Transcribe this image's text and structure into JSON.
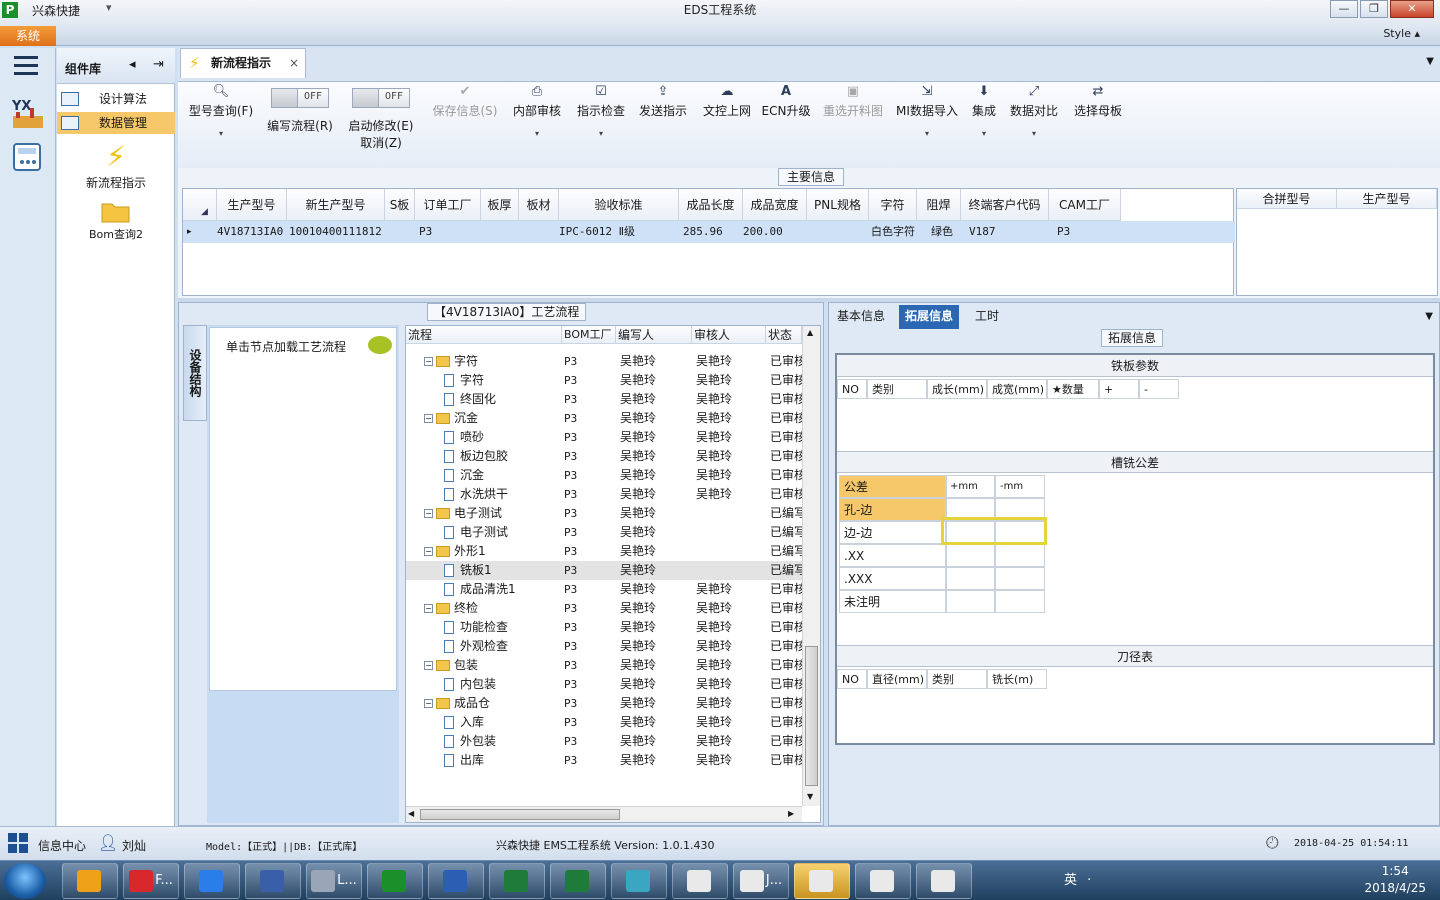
{
  "app": {
    "name": "兴森快捷",
    "title": "EDS工程系统",
    "system_tab": "系统",
    "style_label": "Style"
  },
  "window_buttons": {
    "min": "—",
    "max": "❐",
    "close": "✕"
  },
  "components": {
    "title": "组件库",
    "items": [
      {
        "label": "设计算法"
      },
      {
        "label": "数据管理"
      }
    ],
    "big_buttons": [
      {
        "label": "新流程指示"
      },
      {
        "label": "Bom查询2"
      }
    ]
  },
  "doc_tab": {
    "label": "新流程指示",
    "close": "×"
  },
  "ribbon": [
    {
      "label": "型号查询(F)",
      "icon": "magnifier-icon",
      "dd": "▾"
    },
    {
      "label": "编写流程(R)",
      "toggle": "OFF"
    },
    {
      "label": "启动修改(E)",
      "label2": "取消(Z)",
      "toggle": "OFF"
    },
    {
      "label": "保存信息(S)",
      "icon": "check-icon",
      "disabled": true
    },
    {
      "label": "内部审核",
      "icon": "print-icon",
      "dd": "▾"
    },
    {
      "label": "指示检查",
      "icon": "checkbox-icon",
      "dd": "▾"
    },
    {
      "label": "发送指示",
      "icon": "upload-icon"
    },
    {
      "label": "文控上网",
      "icon": "cloud-upload-icon"
    },
    {
      "label": "ECN升级",
      "icon": "ecn-icon"
    },
    {
      "label": "重选开料图",
      "icon": "image-icon",
      "disabled": true
    },
    {
      "label": "MI数据导入",
      "icon": "import-icon",
      "dd": "▾"
    },
    {
      "label": "集成",
      "icon": "download-icon",
      "dd": "▾"
    },
    {
      "label": "数据对比",
      "icon": "compare-icon",
      "dd": "▾"
    },
    {
      "label": "选择母板",
      "icon": "shuffle-icon"
    }
  ],
  "main_info": {
    "label": "主要信息",
    "columns": [
      "生产型号",
      "新生产型号",
      "S板",
      "订单工厂",
      "板厚",
      "板材",
      "验收标准",
      "成品长度",
      "成品宽度",
      "PNL规格",
      "字符",
      "阻焊",
      "终端客户代码",
      "CAM工厂"
    ],
    "row": [
      "4V18713IA0",
      "10010400111812",
      "",
      "P3",
      "",
      "",
      "IPC-6012 Ⅱ级",
      "285.96",
      "200.00",
      "",
      "白色字符",
      "绿色",
      "V187",
      "P3"
    ],
    "side_columns": [
      "合拼型号",
      "生产型号"
    ]
  },
  "process": {
    "label": "【4V18713IA0】工艺流程",
    "vtab": "设备结构",
    "load_text": "单击节点加载工艺流程",
    "columns": [
      "流程",
      "BOM工厂",
      "编写人",
      "审核人",
      "状态"
    ],
    "rows": [
      {
        "t": "folder",
        "name": "字符",
        "bom": "P3",
        "w": "吴艳玲",
        "a": "吴艳玲",
        "s": "已审核"
      },
      {
        "t": "doc",
        "name": "字符",
        "bom": "P3",
        "w": "吴艳玲",
        "a": "吴艳玲",
        "s": "已审核"
      },
      {
        "t": "doc",
        "name": "终固化",
        "bom": "P3",
        "w": "吴艳玲",
        "a": "吴艳玲",
        "s": "已审核"
      },
      {
        "t": "folder",
        "name": "沉金",
        "bom": "P3",
        "w": "吴艳玲",
        "a": "吴艳玲",
        "s": "已审核"
      },
      {
        "t": "doc",
        "name": "喷砂",
        "bom": "P3",
        "w": "吴艳玲",
        "a": "吴艳玲",
        "s": "已审核"
      },
      {
        "t": "doc",
        "name": "板边包胶",
        "bom": "P3",
        "w": "吴艳玲",
        "a": "吴艳玲",
        "s": "已审核"
      },
      {
        "t": "doc",
        "name": "沉金",
        "bom": "P3",
        "w": "吴艳玲",
        "a": "吴艳玲",
        "s": "已审核"
      },
      {
        "t": "doc",
        "name": "水洗烘干",
        "bom": "P3",
        "w": "吴艳玲",
        "a": "吴艳玲",
        "s": "已审核"
      },
      {
        "t": "folder",
        "name": "电子测试",
        "bom": "P3",
        "w": "吴艳玲",
        "a": "",
        "s": "已编写"
      },
      {
        "t": "doc",
        "name": "电子测试",
        "bom": "P3",
        "w": "吴艳玲",
        "a": "",
        "s": "已编写"
      },
      {
        "t": "folder",
        "name": "外形1",
        "bom": "P3",
        "w": "吴艳玲",
        "a": "",
        "s": "已编写"
      },
      {
        "t": "doc",
        "name": "铣板1",
        "bom": "P3",
        "w": "吴艳玲",
        "a": "",
        "s": "已编写",
        "sel": true
      },
      {
        "t": "doc",
        "name": "成品清洗1",
        "bom": "P3",
        "w": "吴艳玲",
        "a": "吴艳玲",
        "s": "已审核"
      },
      {
        "t": "folder",
        "name": "终检",
        "bom": "P3",
        "w": "吴艳玲",
        "a": "吴艳玲",
        "s": "已审核"
      },
      {
        "t": "doc",
        "name": "功能检查",
        "bom": "P3",
        "w": "吴艳玲",
        "a": "吴艳玲",
        "s": "已审核"
      },
      {
        "t": "doc",
        "name": "外观检查",
        "bom": "P3",
        "w": "吴艳玲",
        "a": "吴艳玲",
        "s": "已审核"
      },
      {
        "t": "folder",
        "name": "包装",
        "bom": "P3",
        "w": "吴艳玲",
        "a": "吴艳玲",
        "s": "已审核"
      },
      {
        "t": "doc",
        "name": "内包装",
        "bom": "P3",
        "w": "吴艳玲",
        "a": "吴艳玲",
        "s": "已审核"
      },
      {
        "t": "folder",
        "name": "成品仓",
        "bom": "P3",
        "w": "吴艳玲",
        "a": "吴艳玲",
        "s": "已审核"
      },
      {
        "t": "doc",
        "name": "入库",
        "bom": "P3",
        "w": "吴艳玲",
        "a": "吴艳玲",
        "s": "已审核"
      },
      {
        "t": "doc",
        "name": "外包装",
        "bom": "P3",
        "w": "吴艳玲",
        "a": "吴艳玲",
        "s": "已审核"
      },
      {
        "t": "doc",
        "name": "出库",
        "bom": "P3",
        "w": "吴艳玲",
        "a": "吴艳玲",
        "s": "已审核"
      }
    ]
  },
  "right": {
    "tabs": [
      "基本信息",
      "拓展信息",
      "工时"
    ],
    "active_tab": 1,
    "ext_label": "拓展信息",
    "steel": {
      "title": "铁板参数",
      "cols": [
        "NO",
        "类别",
        "成长(mm)",
        "成宽(mm)",
        "★数量",
        "+",
        "-"
      ]
    },
    "tol": {
      "title": "槽铣公差",
      "head": [
        "公差",
        "+mm",
        "-mm"
      ],
      "rows": [
        "孔-边",
        "边-边",
        ".XX",
        ".XXX",
        "未注明"
      ]
    },
    "tool": {
      "title": "刀径表",
      "cols": [
        "NO",
        "直径(mm)",
        "类别",
        "铣长(m)"
      ]
    }
  },
  "status": {
    "info": "信息中心",
    "user": "刘灿",
    "model": "Model:【正式】||DB:【正式库】",
    "version": "兴森快捷 EMS工程系统 Version: 1.0.1.430",
    "datetime": "2018-04-25 01:54:11"
  },
  "taskbar": {
    "time": "1:54",
    "date": "2018/4/25",
    "items": [
      "",
      "F...",
      "",
      "",
      "L...",
      "",
      "",
      "",
      "",
      "",
      "",
      "J...",
      "",
      "",
      ""
    ],
    "tray": "英 ·"
  }
}
